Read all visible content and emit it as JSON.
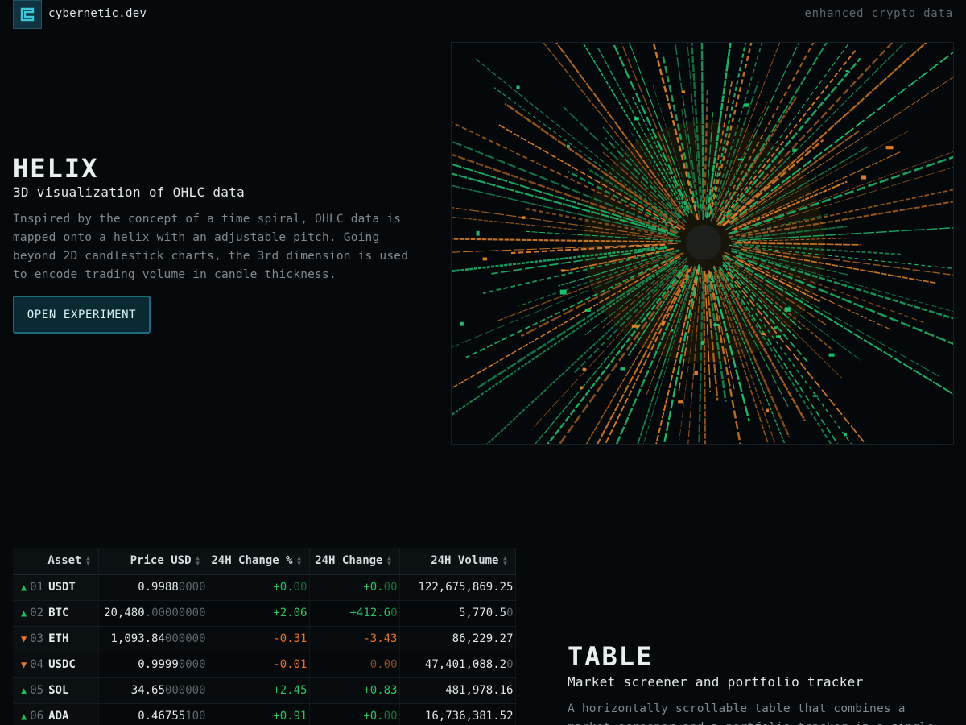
{
  "header": {
    "logo_icon": "bracket-logo-icon",
    "site_name": "cybernetic.dev",
    "tagline": "enhanced crypto data"
  },
  "helix": {
    "title": "HELIX",
    "subtitle": "3D visualization of OHLC data",
    "description": "Inspired by the concept of a time spiral, OHLC data is mapped onto a helix with an adjustable pitch. Going beyond 2D candlestick charts, the 3rd dimension is used to encode trading volume in candle thickness.",
    "button_label": "OPEN EXPERIMENT",
    "colors": {
      "up": "#1fd27a",
      "down": "#f08a2a",
      "accent": "#1d6a7c"
    }
  },
  "table": {
    "columns": [
      {
        "label": "Asset"
      },
      {
        "label": "Price USD"
      },
      {
        "label": "24H Change %"
      },
      {
        "label": "24H Change"
      },
      {
        "label": "24H Volume"
      }
    ],
    "rows": [
      {
        "direction": "up",
        "rank": "01",
        "symbol": "USDT",
        "price_main": "0.9988",
        "price_dim": "0000",
        "pct": "+0.00",
        "pct_main": "+0.",
        "pct_dim": "00",
        "chg_main": "+0.",
        "chg_dim": "00",
        "chg_sign": "pos",
        "vol": "122,675,869.25"
      },
      {
        "direction": "up",
        "rank": "02",
        "symbol": "BTC",
        "price_main": "20,480",
        "price_dim": ".00000000",
        "pct_main": "+2.06",
        "pct_dim": "",
        "chg_main": "+412.6",
        "chg_dim": "0",
        "chg_sign": "pos",
        "vol": "5,770.50",
        "vol_main": "5,770.5",
        "vol_dim": "0"
      },
      {
        "direction": "down",
        "rank": "03",
        "symbol": "ETH",
        "price_main": "1,093.84",
        "price_dim": "000000",
        "pct_main": "-0.31",
        "pct_dim": "",
        "chg_main": "-3.43",
        "chg_dim": "",
        "chg_sign": "neg",
        "vol": "86,229.27"
      },
      {
        "direction": "down",
        "rank": "04",
        "symbol": "USDC",
        "price_main": "0.9999",
        "price_dim": "0000",
        "pct_main": "-0.01",
        "pct_dim": "",
        "chg_main": "0.",
        "chg_dim": "00",
        "chg_sign": "negdim",
        "vol": "47,401,088.20",
        "vol_main": "47,401,088.2",
        "vol_dim": "0"
      },
      {
        "direction": "up",
        "rank": "05",
        "symbol": "SOL",
        "price_main": "34.65",
        "price_dim": "000000",
        "pct_main": "+2.45",
        "pct_dim": "",
        "chg_main": "+0.83",
        "chg_dim": "",
        "chg_sign": "pos",
        "vol": "481,978.16"
      },
      {
        "direction": "up",
        "rank": "06",
        "symbol": "ADA",
        "price_main": "0.46755",
        "price_dim": "100",
        "pct_main": "+0.91",
        "pct_dim": "",
        "chg_main": "+0.",
        "chg_dim": "00",
        "chg_sign": "pos",
        "vol": "16,736,381.52"
      }
    ]
  },
  "table_section": {
    "title": "TABLE",
    "subtitle": "Market screener and portfolio tracker",
    "description": "A horizontally scrollable table that combines a market screener and a portfolio tracker in a single"
  }
}
